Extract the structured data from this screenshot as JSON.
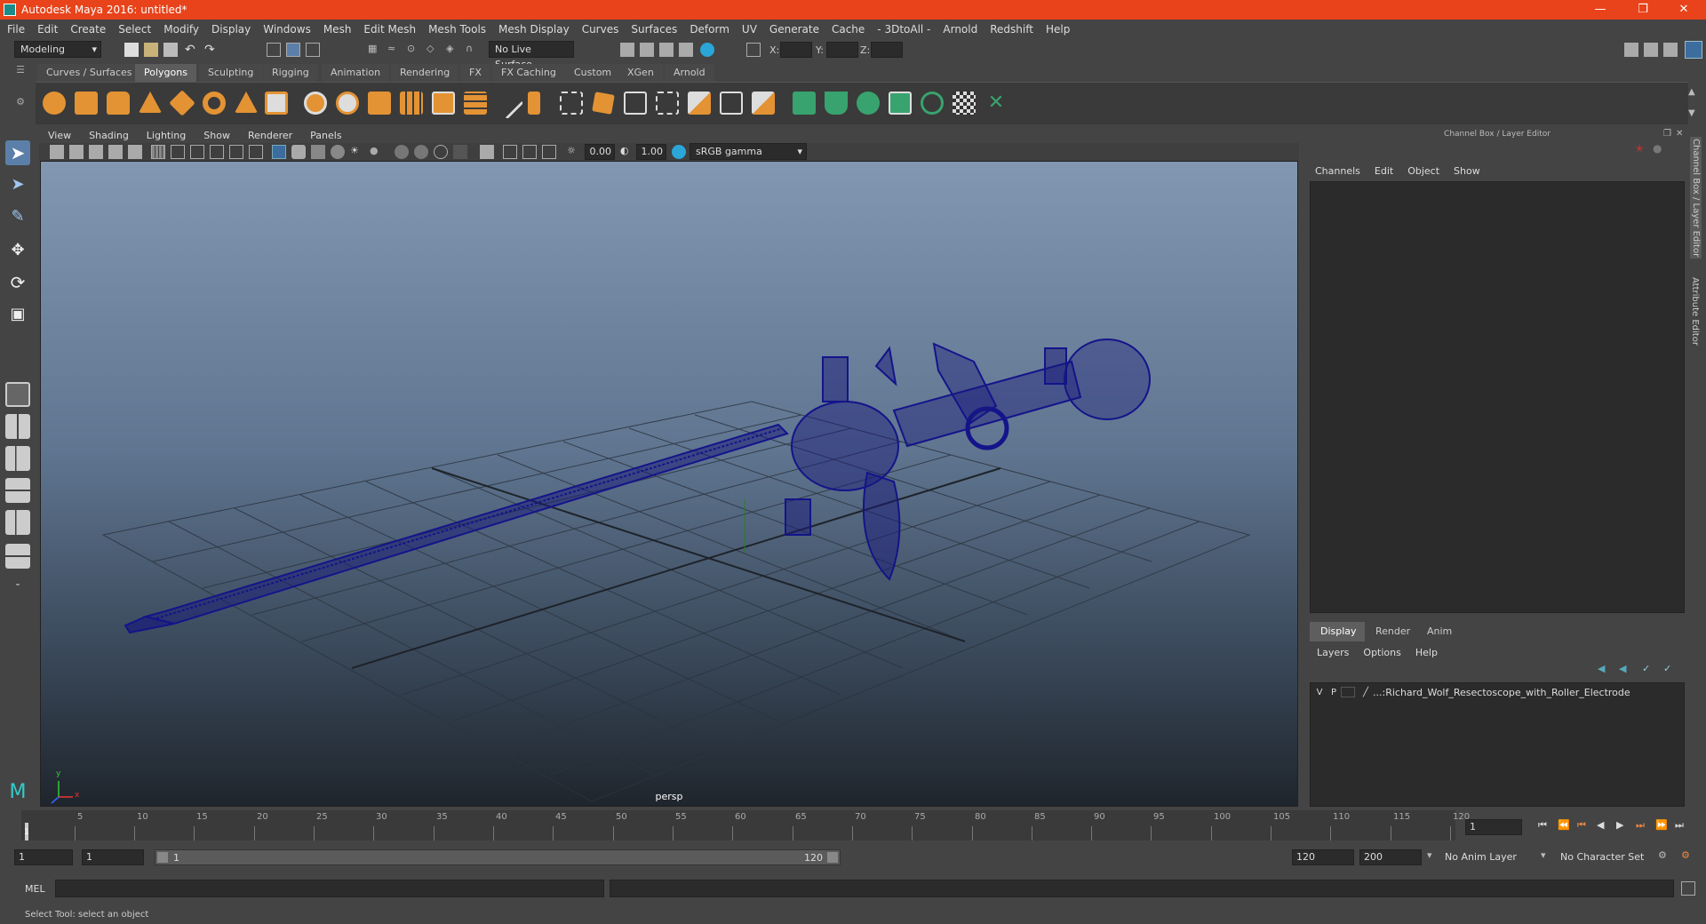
{
  "window": {
    "title": "Autodesk Maya 2016: untitled*"
  },
  "menus": [
    "File",
    "Edit",
    "Create",
    "Select",
    "Modify",
    "Display",
    "Windows",
    "Mesh",
    "Edit Mesh",
    "Mesh Tools",
    "Mesh Display",
    "Curves",
    "Surfaces",
    "Deform",
    "UV",
    "Generate",
    "Cache",
    "- 3DtoAll -",
    "Arnold",
    "Redshift",
    "Help"
  ],
  "status": {
    "mode": "Modeling",
    "live_surface": "No Live Surface",
    "x_label": "X:",
    "y_label": "Y:",
    "z_label": "Z:"
  },
  "shelf_tabs": [
    "Curves / Surfaces",
    "Polygons",
    "Sculpting",
    "Rigging",
    "Animation",
    "Rendering",
    "FX",
    "FX Caching",
    "Custom",
    "XGen",
    "Arnold"
  ],
  "active_shelf": "Polygons",
  "viewport": {
    "menus": [
      "View",
      "Shading",
      "Lighting",
      "Show",
      "Renderer",
      "Panels"
    ],
    "exposure": "0.00",
    "gamma": "1.00",
    "color_space": "sRGB gamma",
    "camera_label": "persp",
    "axis_y": "y",
    "axis_x": "x"
  },
  "channel_box": {
    "title": "Channel Box / Layer Editor",
    "menus": [
      "Channels",
      "Edit",
      "Object",
      "Show"
    ]
  },
  "layer_editor": {
    "tabs": [
      "Display",
      "Render",
      "Anim"
    ],
    "active_tab": "Display",
    "menus": [
      "Layers",
      "Options",
      "Help"
    ],
    "layer": {
      "v": "V",
      "p": "P",
      "name": "...:Richard_Wolf_Resectoscope_with_Roller_Electrode"
    }
  },
  "side_tabs": [
    "Channel Box / Layer Editor",
    "Attribute Editor"
  ],
  "timeline": {
    "ticks": [
      "5",
      "10",
      "15",
      "20",
      "25",
      "30",
      "35",
      "40",
      "45",
      "50",
      "55",
      "60",
      "65",
      "70",
      "75",
      "80",
      "85",
      "90",
      "95",
      "100",
      "105",
      "110",
      "115",
      "120"
    ],
    "start_marker": "1",
    "current_frame": "1"
  },
  "range": {
    "start": "1",
    "playback_start": "1",
    "slider_start": "1",
    "slider_end": "120",
    "playback_end": "120",
    "end": "200",
    "anim_layer": "No Anim Layer",
    "character_set": "No Character Set"
  },
  "command": {
    "label": "MEL"
  },
  "help_line": "Select Tool: select an object"
}
